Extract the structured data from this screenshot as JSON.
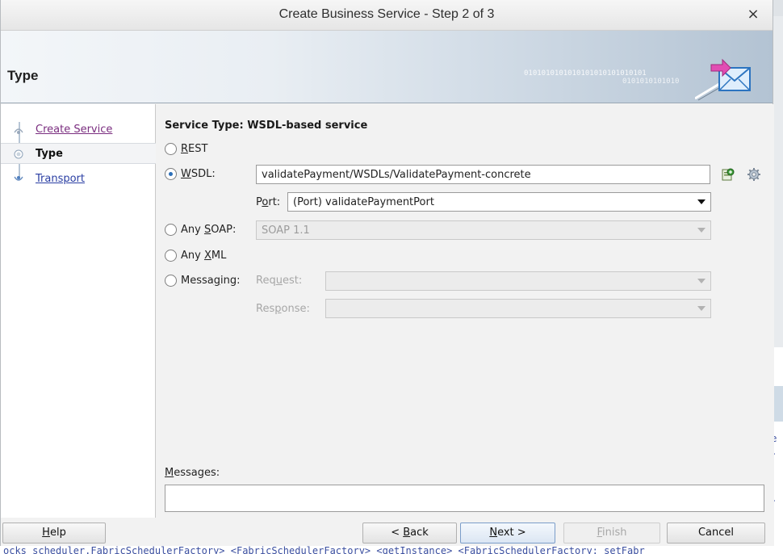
{
  "dialog": {
    "title": "Create Business Service - Step 2 of 3",
    "close_glyph": "×",
    "header_title": "Type",
    "binary_text_1": "0101010101010101010101010101",
    "binary_text_2": "0101010101010"
  },
  "nav": {
    "items": [
      {
        "label": "Create Service",
        "state": "visited"
      },
      {
        "label": "Type",
        "state": "active"
      },
      {
        "label": "Transport",
        "state": "link"
      }
    ]
  },
  "form": {
    "section_title": "Service Type: WSDL-based service",
    "options": {
      "rest": {
        "mnemonic": "R",
        "rest": "EST"
      },
      "wsdl": {
        "mnemonic": "W",
        "rest": "SDL:",
        "value": "validatePayment/WSDLs/ValidatePayment-concrete",
        "selected": true
      },
      "port": {
        "prefix": "P",
        "mnemonic": "o",
        "rest": "rt:",
        "value": "(Port) validatePaymentPort"
      },
      "any_soap": {
        "prefix": "Any ",
        "mnemonic": "S",
        "rest": "OAP:",
        "value": "SOAP 1.1"
      },
      "any_xml": {
        "prefix": "Any ",
        "mnemonic": "X",
        "rest": "ML"
      },
      "messaging": {
        "prefix": "Messa",
        "mnemonic": "g",
        "rest": "ing:"
      },
      "request": {
        "prefix": "Req",
        "mnemonic": "u",
        "rest": "est:"
      },
      "response": {
        "prefix": "Res",
        "mnemonic": "p",
        "rest": "onse:"
      }
    },
    "messages": {
      "mnemonic": "M",
      "rest": "essages:"
    }
  },
  "footer": {
    "help": {
      "mnemonic": "H",
      "rest": "elp"
    },
    "back": {
      "prefix": "< ",
      "mnemonic": "B",
      "rest": "ack"
    },
    "next": {
      "mnemonic": "N",
      "rest": "ext >"
    },
    "finish": {
      "mnemonic": "F",
      "rest": "inish"
    },
    "cancel": "Cancel"
  },
  "background": {
    "log_line": "ocks scheduler.FabricSchedulerFactory> <FabricSchedulerFactory> <getInstance> <FabricSchedulerFactory: setFabr",
    "right_fragments": [
      ".e",
      "d.",
      "n.",
      "r"
    ]
  },
  "colors": {
    "link": "#2a3ea3",
    "visited": "#7a2d7f",
    "radio_selected": "#2d6fb8"
  },
  "icons": [
    "close-icon",
    "wizard-envelope-icon",
    "browse-wsdl-icon",
    "settings-gear-icon",
    "step-dot-icon"
  ]
}
